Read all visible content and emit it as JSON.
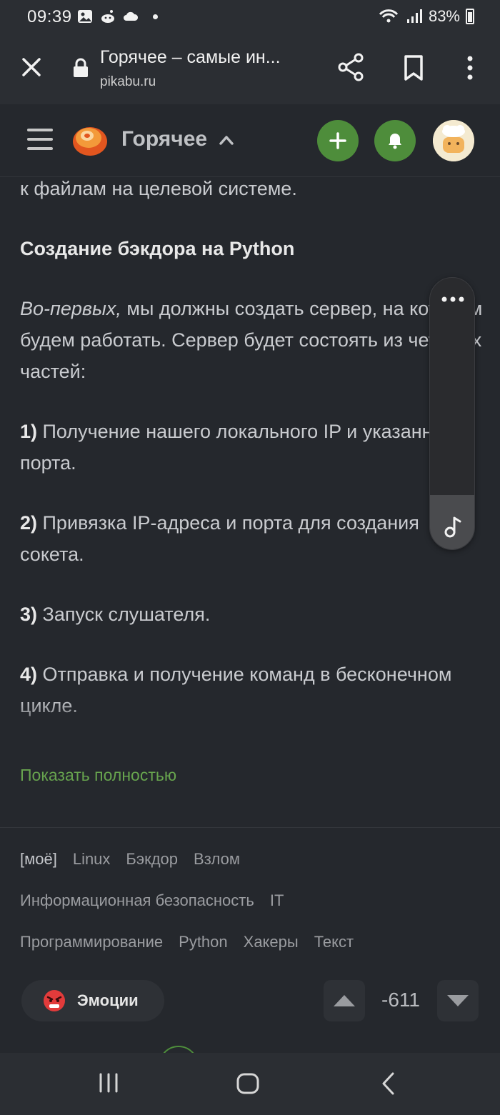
{
  "status_bar": {
    "time": "09:39",
    "battery": "83%"
  },
  "browser": {
    "title": "Горячее – самые ин...",
    "url": "pikabu.ru"
  },
  "header": {
    "title": "Горячее"
  },
  "article": {
    "lines_top": "выполнять команды и получить удаленный доступ к файлам на целевой системе.",
    "heading": "Создание бэкдора на Python",
    "intro_italic": "Во-первых,",
    "intro_rest": " мы должны создать сервер, на котором будем работать. Сервер будет состоять из четырех частей:",
    "steps": [
      {
        "num": "1)",
        "text": " Получение нашего локального IP и указанного порта."
      },
      {
        "num": "2)",
        "text": " Привязка IP-адреса и порта для создания сокета."
      },
      {
        "num": "3)",
        "text": " Запуск слушателя."
      },
      {
        "num": "4)",
        "text": " Отправка и получение команд в бесконечном цикле."
      }
    ]
  },
  "show_more": "Показать полностью",
  "tags": [
    [
      "[моё]",
      "Linux",
      "Бэкдор",
      "Взлом"
    ],
    [
      "Информационная безопасность",
      "IT"
    ],
    [
      "Программирование",
      "Python",
      "Хакеры",
      "Текст"
    ]
  ],
  "emotions_label": "Эмоции",
  "rating": "-611",
  "player": {
    "level": 0.2
  },
  "colors": {
    "accent": "#4e8d3b",
    "link": "#67a34e",
    "background": "#25282d"
  }
}
